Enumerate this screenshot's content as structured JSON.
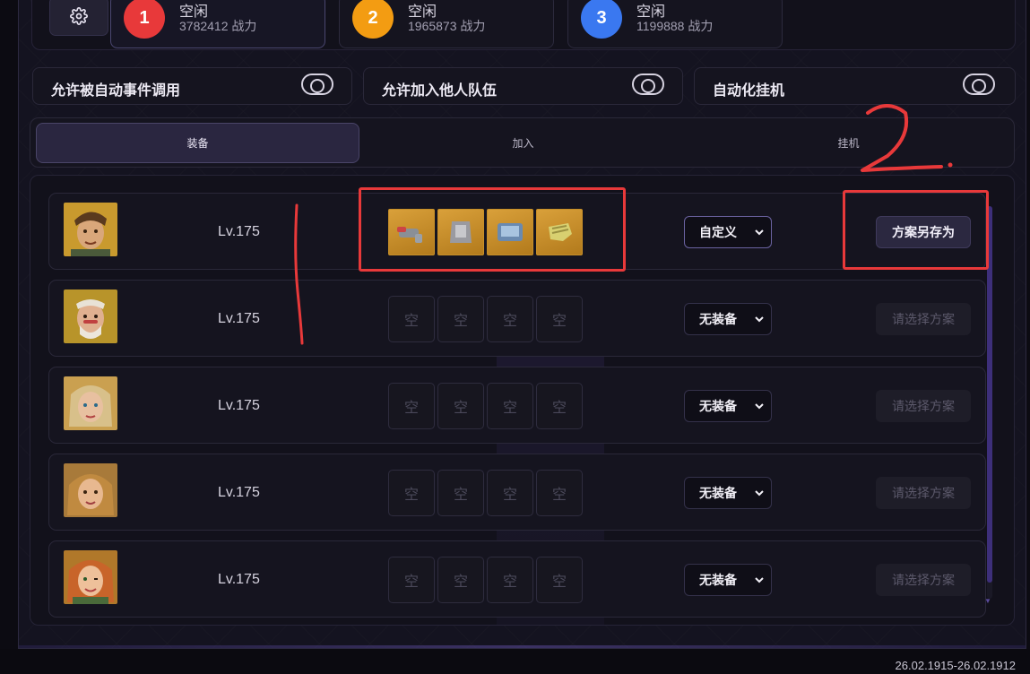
{
  "teams": [
    {
      "number": "1",
      "status": "空闲",
      "power": "3782412 战力",
      "color": "#e8393a"
    },
    {
      "number": "2",
      "status": "空闲",
      "power": "1965873 战力",
      "color": "#f39c12"
    },
    {
      "number": "3",
      "status": "空闲",
      "power": "1199888 战力",
      "color": "#3a78f0"
    }
  ],
  "toggles": [
    {
      "label": "允许被自动事件调用"
    },
    {
      "label": "允许加入他人队伍"
    },
    {
      "label": "自动化挂机"
    }
  ],
  "tabs": [
    {
      "label": "装备",
      "active": true
    },
    {
      "label": "加入",
      "active": false
    },
    {
      "label": "挂机",
      "active": false
    }
  ],
  "rows": [
    {
      "level": "Lv.175",
      "select": "自定义",
      "action": "方案另存为",
      "action_enabled": true,
      "slots": [
        "",
        "",
        "",
        ""
      ],
      "filled": true
    },
    {
      "level": "Lv.175",
      "select": "无装备",
      "action": "请选择方案",
      "action_enabled": false,
      "slots": [
        "空",
        "空",
        "空",
        "空"
      ],
      "filled": false
    },
    {
      "level": "Lv.175",
      "select": "无装备",
      "action": "请选择方案",
      "action_enabled": false,
      "slots": [
        "空",
        "空",
        "空",
        "空"
      ],
      "filled": false
    },
    {
      "level": "Lv.175",
      "select": "无装备",
      "action": "请选择方案",
      "action_enabled": false,
      "slots": [
        "空",
        "空",
        "空",
        "空"
      ],
      "filled": false
    },
    {
      "level": "Lv.175",
      "select": "无装备",
      "action": "请选择方案",
      "action_enabled": false,
      "slots": [
        "空",
        "空",
        "空",
        "空"
      ],
      "filled": false
    }
  ],
  "timestamp": "26.02.1915-26.02.1912",
  "annotation_color": "#e8393a"
}
